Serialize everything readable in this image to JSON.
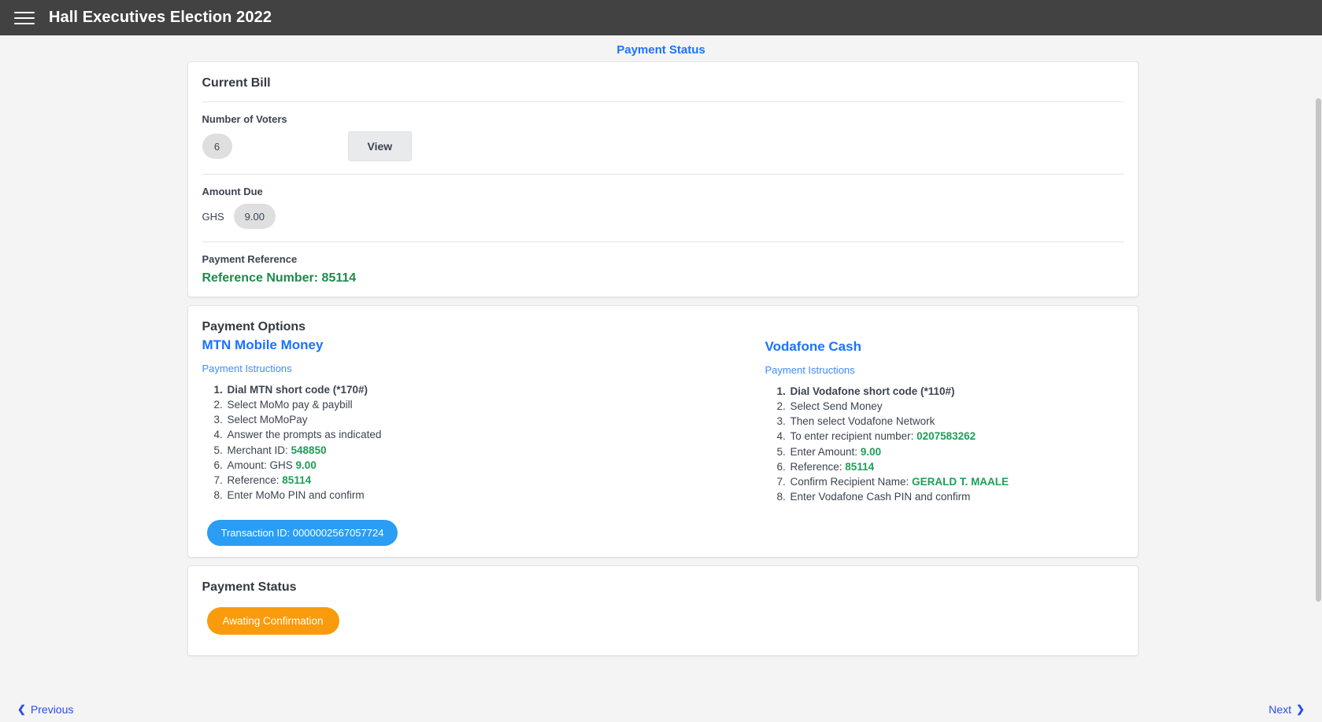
{
  "appbar": {
    "menu_icon": "hamburger-menu-icon",
    "title": "Hall Executives Election 2022"
  },
  "page": {
    "title": "Payment Status"
  },
  "current_bill": {
    "card_title": "Current Bill",
    "voters_label": "Number of Voters",
    "voters_count": "6",
    "view_button": "View",
    "amount_label": "Amount Due",
    "currency": "GHS",
    "amount_value": "9.00",
    "reference_label": "Payment Reference",
    "reference_text": "Reference Number: 85114"
  },
  "payment_options": {
    "card_title": "Payment Options",
    "mtn": {
      "provider": "MTN Mobile Money",
      "instructions_link": "Payment Istructions",
      "steps": [
        {
          "text": "Dial MTN short code (*170#)",
          "bold": true
        },
        {
          "text": "Select MoMo pay & paybill",
          "bold": false
        },
        {
          "text": "Select MoMoPay",
          "bold": false
        },
        {
          "text": "Answer the prompts as indicated",
          "bold": false
        },
        {
          "text": "Merchant ID: ",
          "value": "548850",
          "bold": false
        },
        {
          "text": "Amount: GHS ",
          "value": "9.00",
          "bold": false
        },
        {
          "text": "Reference: ",
          "value": "85114",
          "bold": false
        },
        {
          "text": "Enter MoMo PIN and confirm",
          "bold": false
        }
      ],
      "transaction_badge": "Transaction ID: 0000002567057724"
    },
    "vodafone": {
      "provider": "Vodafone Cash",
      "instructions_link": "Payment Istructions",
      "steps": [
        {
          "text": "Dial Vodafone short code (*110#)",
          "bold": true
        },
        {
          "text": "Select Send Money",
          "bold": false
        },
        {
          "text": "Then select Vodafone Network",
          "bold": false
        },
        {
          "text": "To enter recipient number: ",
          "value": "0207583262",
          "bold": false
        },
        {
          "text": "Enter Amount: ",
          "value": "9.00",
          "bold": false
        },
        {
          "text": "Reference: ",
          "value": "85114",
          "bold": false
        },
        {
          "text": "Confirm Recipient Name: ",
          "value": "GERALD T. MAALE",
          "bold": false
        },
        {
          "text": "Enter Vodafone Cash PIN and confirm",
          "bold": false
        }
      ]
    }
  },
  "payment_status": {
    "card_title": "Payment Status",
    "status_badge": "Awating Confirmation"
  },
  "footer": {
    "previous": "Previous",
    "next": "Next",
    "prev_icon": "chevron-left-icon",
    "next_icon": "chevron-right-icon"
  },
  "colors": {
    "appbar": "#424242",
    "accent_blue": "#1a73ff",
    "link_blue": "#3d8bfd",
    "value_green": "#1e9e57",
    "reference_green": "#1e8a4c",
    "badge_blue": "#2a9df4",
    "badge_orange": "#f99b0c",
    "page_bg": "#f4f4f4"
  }
}
